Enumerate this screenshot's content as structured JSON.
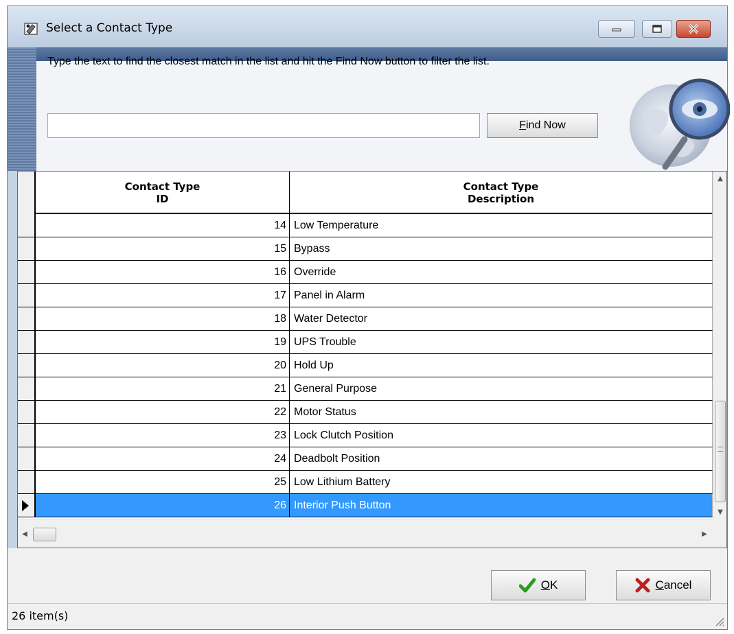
{
  "window": {
    "title": "Select a Contact Type",
    "icon": "contact-type-app-icon"
  },
  "header": {
    "instruction": "Type the text to find the closest match in the list and hit the Find Now button to filter the list.",
    "search_value": "",
    "find_button": {
      "mnemonic": "F",
      "rest": "ind Now"
    },
    "graphic": "magnifier-globe-icon"
  },
  "grid": {
    "columns": [
      {
        "line1": "Contact Type",
        "line2": "ID"
      },
      {
        "line1": "Contact Type",
        "line2": "Description"
      }
    ],
    "rows": [
      {
        "id": "14",
        "description": "Low Temperature",
        "selected": false
      },
      {
        "id": "15",
        "description": "Bypass",
        "selected": false
      },
      {
        "id": "16",
        "description": "Override",
        "selected": false
      },
      {
        "id": "17",
        "description": "Panel in Alarm",
        "selected": false
      },
      {
        "id": "18",
        "description": "Water Detector",
        "selected": false
      },
      {
        "id": "19",
        "description": "UPS Trouble",
        "selected": false
      },
      {
        "id": "20",
        "description": "Hold Up",
        "selected": false
      },
      {
        "id": "21",
        "description": "General Purpose",
        "selected": false
      },
      {
        "id": "22",
        "description": "Motor Status",
        "selected": false
      },
      {
        "id": "23",
        "description": "Lock Clutch Position",
        "selected": false
      },
      {
        "id": "24",
        "description": "Deadbolt Position",
        "selected": false
      },
      {
        "id": "25",
        "description": "Low Lithium Battery",
        "selected": false
      },
      {
        "id": "26",
        "description": "Interior Push Button",
        "selected": true
      }
    ],
    "selection_color": "#3399ff"
  },
  "buttons": {
    "ok": {
      "mnemonic": "O",
      "rest": "K",
      "icon": "checkmark-icon"
    },
    "cancel": {
      "mnemonic": "C",
      "rest": "ancel",
      "icon": "x-icon"
    }
  },
  "status": {
    "text": "26 item(s)"
  },
  "colors": {
    "accent": "#3399ff",
    "check_green": "#2a9d1f",
    "cancel_red": "#c21f1f"
  }
}
